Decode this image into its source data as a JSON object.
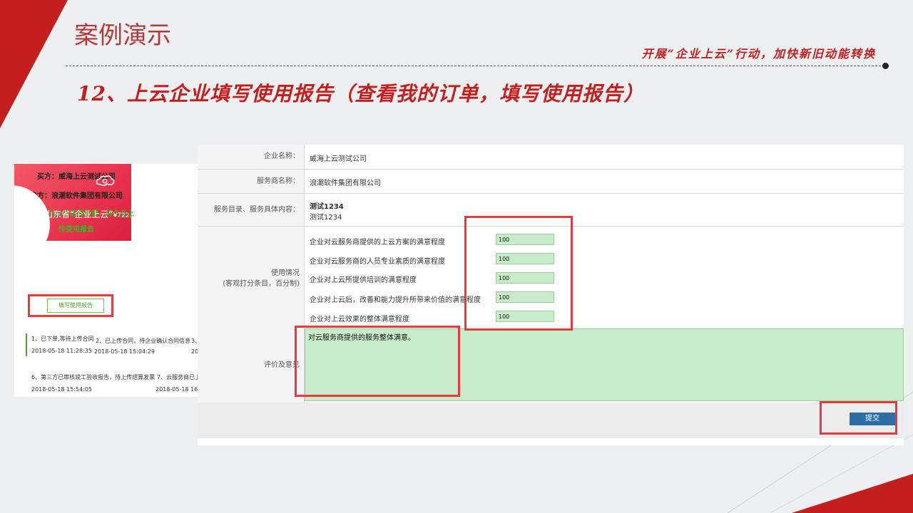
{
  "slide": {
    "title": "案例演示",
    "slogan": "开展“企业上云”行动，加快新旧动能转换",
    "subtitle": "12、上云企业填写使用报告（查看我的订单，填写使用报告）"
  },
  "order_panel": {
    "buyer": "买方：威海上云测试公司",
    "seller": "卖方：浪潮软件集团有限公司",
    "status_line1": "云服务商已上传结算发票，待企业上",
    "status_line2": "传使用报告",
    "promo_text": "山东省“企业上云”",
    "promo_price": "¥722.00/次费",
    "report_button": "填写使用报告",
    "timeline": [
      {
        "text": "1、已下单,等待上传合同",
        "date": "2018-05-18 11:28:35"
      },
      {
        "text": "2、已上传合同，待企业确认合同信息",
        "date": "2018-05-18 15:04:29"
      },
      {
        "text": "3、",
        "date": "20"
      },
      {
        "text": "6、第三方已审核竣工验收报告，待上传结算发票",
        "date": "2018-05-18 15:54:05"
      },
      {
        "text": "7、云服务商已上",
        "date": "2018-05-18 16:0"
      }
    ]
  },
  "form": {
    "company_label": "企业名称：",
    "company_value": "威海上云测试公司",
    "provider_label": "服务商名称：",
    "provider_value": "浪潮软件集团有限公司",
    "catalog_label": "服务目录、服务具体内容：",
    "catalog_title": "测试1234",
    "catalog_detail": "测试1234",
    "usage_label": "使用情况",
    "usage_sublabel": "(客观打分条目，百分制)",
    "questions": [
      {
        "q": "企业对云服务商提供的上云方案的满意程度",
        "score": "100"
      },
      {
        "q": "企业对云服务商的人员专业素质的满意程度",
        "score": "100"
      },
      {
        "q": "企业对上云所提供培训的满意程度",
        "score": "100"
      },
      {
        "q": "企业对上云后，改善和能力提升所带来价值的满意程度",
        "score": "100"
      },
      {
        "q": "企业对上云效果的整体满意程度",
        "score": "100"
      }
    ],
    "comment_label": "评价及意见",
    "comment_value": "对云服务商提供的服务整体满意。",
    "submit": "提交"
  },
  "colors": {
    "accent_red": "#c41f1f",
    "highlight_red": "#e63b3b",
    "input_green": "#c8ecc9",
    "submit_blue": "#2b6fa6",
    "status_green": "#4fa82a"
  }
}
